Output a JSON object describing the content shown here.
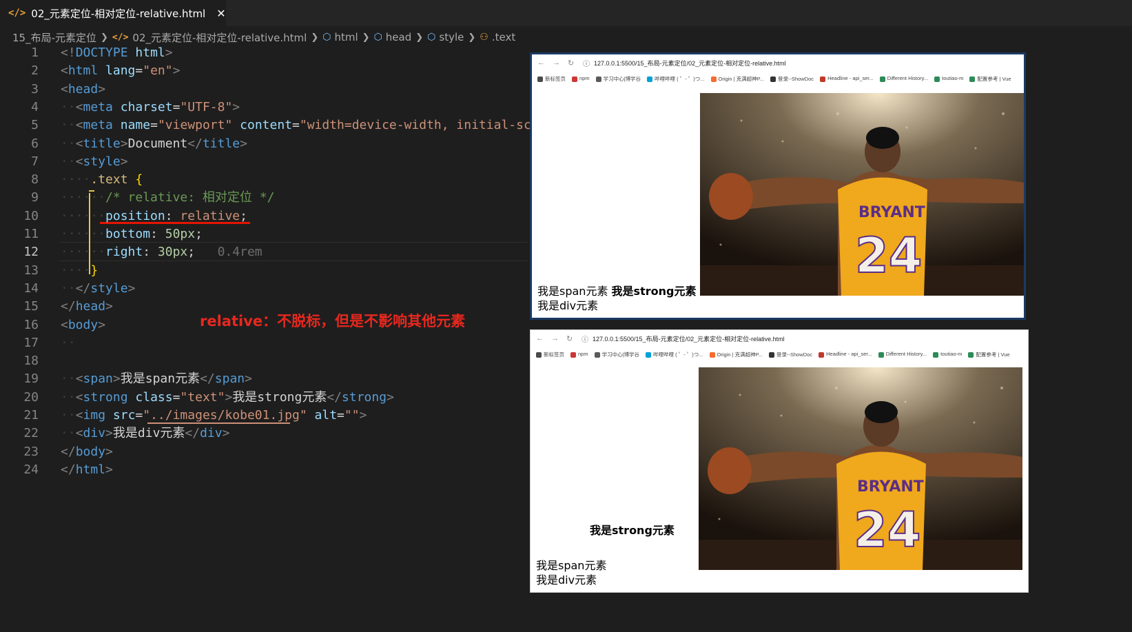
{
  "tab": {
    "title": "02_元素定位-相对定位-relative.html",
    "icon": "code-file-icon",
    "close": "✕"
  },
  "breadcrumb": [
    "15_布局-元素定位",
    "02_元素定位-相对定位-relative.html",
    "html",
    "head",
    "style",
    ".text"
  ],
  "editor": {
    "current_line": 12,
    "line_numbers": [
      "1",
      "2",
      "3",
      "4",
      "5",
      "6",
      "7",
      "8",
      "9",
      "10",
      "11",
      "12",
      "13",
      "14",
      "15",
      "16",
      "17",
      "18",
      "19",
      "20",
      "21",
      "22",
      "23",
      "24"
    ],
    "inlay_hint": "0.4rem",
    "annotation": "relative：不脱标，但是不影响其他元素"
  },
  "code_lines": [
    [
      [
        "<!",
        "p"
      ],
      [
        "DOCTYPE",
        "tag"
      ],
      [
        " ",
        "x"
      ],
      [
        "html",
        "attr"
      ],
      [
        ">",
        "p"
      ]
    ],
    [
      [
        "<",
        "p"
      ],
      [
        "html",
        "tag"
      ],
      [
        " ",
        "x"
      ],
      [
        "lang",
        "attr"
      ],
      [
        "=",
        "x"
      ],
      [
        "\"en\"",
        "str"
      ],
      [
        ">",
        "p"
      ]
    ],
    [
      [
        "<",
        "p"
      ],
      [
        "head",
        "tag"
      ],
      [
        ">",
        "p"
      ]
    ],
    [
      [
        "··",
        "d"
      ],
      [
        "<",
        "p"
      ],
      [
        "meta",
        "tag"
      ],
      [
        " ",
        "x"
      ],
      [
        "charset",
        "attr"
      ],
      [
        "=",
        "x"
      ],
      [
        "\"UTF-8\"",
        "str"
      ],
      [
        ">",
        "p"
      ]
    ],
    [
      [
        "··",
        "d"
      ],
      [
        "<",
        "p"
      ],
      [
        "meta",
        "tag"
      ],
      [
        " ",
        "x"
      ],
      [
        "name",
        "attr"
      ],
      [
        "=",
        "x"
      ],
      [
        "\"viewport\"",
        "str"
      ],
      [
        " ",
        "x"
      ],
      [
        "content",
        "attr"
      ],
      [
        "=",
        "x"
      ],
      [
        "\"width=device-width, initial-scal",
        "str"
      ]
    ],
    [
      [
        "··",
        "d"
      ],
      [
        "<",
        "p"
      ],
      [
        "title",
        "tag"
      ],
      [
        ">",
        "p"
      ],
      [
        "Document",
        "x"
      ],
      [
        "</",
        "p"
      ],
      [
        "title",
        "tag"
      ],
      [
        ">",
        "p"
      ]
    ],
    [
      [
        "··",
        "d"
      ],
      [
        "<",
        "p"
      ],
      [
        "style",
        "tag"
      ],
      [
        ">",
        "p"
      ]
    ],
    [
      [
        "····",
        "d"
      ],
      [
        ".text",
        "sel"
      ],
      [
        " ",
        "x"
      ],
      [
        "{",
        "brace"
      ]
    ],
    [
      [
        "······",
        "d"
      ],
      [
        "/* relative: 相对定位 */",
        "com"
      ]
    ],
    [
      [
        "······",
        "d"
      ],
      [
        "position",
        "prop"
      ],
      [
        ": ",
        "x"
      ],
      [
        "relative",
        "val"
      ],
      [
        ";",
        "x"
      ]
    ],
    [
      [
        "······",
        "d"
      ],
      [
        "bottom",
        "prop"
      ],
      [
        ": ",
        "x"
      ],
      [
        "50px",
        "num"
      ],
      [
        ";",
        "x"
      ]
    ],
    [
      [
        "······",
        "d"
      ],
      [
        "right",
        "prop"
      ],
      [
        ": ",
        "x"
      ],
      [
        "30px",
        "num"
      ],
      [
        ";",
        "x"
      ]
    ],
    [
      [
        "····",
        "d"
      ],
      [
        "}",
        "brace"
      ]
    ],
    [
      [
        "··",
        "d"
      ],
      [
        "</",
        "p"
      ],
      [
        "style",
        "tag"
      ],
      [
        ">",
        "p"
      ]
    ],
    [
      [
        "</",
        "p"
      ],
      [
        "head",
        "tag"
      ],
      [
        ">",
        "p"
      ]
    ],
    [
      [
        "<",
        "p"
      ],
      [
        "body",
        "tag"
      ],
      [
        ">",
        "p"
      ]
    ],
    [
      [
        "··",
        "d"
      ]
    ],
    [],
    [
      [
        "··",
        "d"
      ],
      [
        "<",
        "p"
      ],
      [
        "span",
        "tag"
      ],
      [
        ">",
        "p"
      ],
      [
        "我是span元素",
        "x"
      ],
      [
        "</",
        "p"
      ],
      [
        "span",
        "tag"
      ],
      [
        ">",
        "p"
      ]
    ],
    [
      [
        "··",
        "d"
      ],
      [
        "<",
        "p"
      ],
      [
        "strong",
        "tag"
      ],
      [
        " ",
        "x"
      ],
      [
        "class",
        "attr"
      ],
      [
        "=",
        "x"
      ],
      [
        "\"text\"",
        "str"
      ],
      [
        ">",
        "p"
      ],
      [
        "我是strong元素",
        "x"
      ],
      [
        "</",
        "p"
      ],
      [
        "strong",
        "tag"
      ],
      [
        ">",
        "p"
      ]
    ],
    [
      [
        "··",
        "d"
      ],
      [
        "<",
        "p"
      ],
      [
        "img",
        "tag"
      ],
      [
        " ",
        "x"
      ],
      [
        "src",
        "attr"
      ],
      [
        "=",
        "x"
      ],
      [
        "\"../images/kobe01.jpg\"",
        "str"
      ],
      [
        " ",
        "x"
      ],
      [
        "alt",
        "attr"
      ],
      [
        "=",
        "x"
      ],
      [
        "\"\"",
        "str"
      ],
      [
        ">",
        "p"
      ]
    ],
    [
      [
        "··",
        "d"
      ],
      [
        "<",
        "p"
      ],
      [
        "div",
        "tag"
      ],
      [
        ">",
        "p"
      ],
      [
        "我是div元素",
        "x"
      ],
      [
        "</",
        "p"
      ],
      [
        "div",
        "tag"
      ],
      [
        ">",
        "p"
      ]
    ],
    [
      [
        "</",
        "p"
      ],
      [
        "body",
        "tag"
      ],
      [
        ">",
        "p"
      ]
    ],
    [
      [
        "</",
        "p"
      ],
      [
        "html",
        "tag"
      ],
      [
        ">",
        "p"
      ]
    ]
  ],
  "browser": {
    "url": "127.0.0.1:5500/15_布局-元素定位/02_元素定位-相对定位-relative.html",
    "bookmarks": [
      {
        "label": "新标签页",
        "color": "#4a4a4a"
      },
      {
        "label": "npm",
        "color": "#cb3837"
      },
      {
        "label": "学习中心|博学谷",
        "color": "#5a5a5a"
      },
      {
        "label": "哔哩哔哩 ( ゜- ゜)つ...",
        "color": "#00a1d6"
      },
      {
        "label": "Origin | 克满超神P...",
        "color": "#f56c2d"
      },
      {
        "label": "登录--ShowDoc",
        "color": "#333333"
      },
      {
        "label": "Headline - api_ser...",
        "color": "#c0392b"
      },
      {
        "label": "Different History...",
        "color": "#2e8b57"
      },
      {
        "label": "toutiao-m",
        "color": "#2e8b57"
      },
      {
        "label": "配置参考 | Vue",
        "color": "#2e8b57"
      }
    ]
  },
  "browser_one": {
    "span": "我是span元素",
    "strong": "我是strong元素",
    "div": "我是div元素"
  },
  "browser_two": {
    "span": "我是span元素",
    "strong": "我是strong元素",
    "div": "我是div元素"
  },
  "photo": {
    "name": "BRYANT",
    "number": "24"
  },
  "colors": {
    "editor_bg": "#1e1e1e",
    "annotation": "#e8281e",
    "tag": "#569cd6",
    "attr": "#9cdcfe",
    "string": "#ce9178"
  }
}
